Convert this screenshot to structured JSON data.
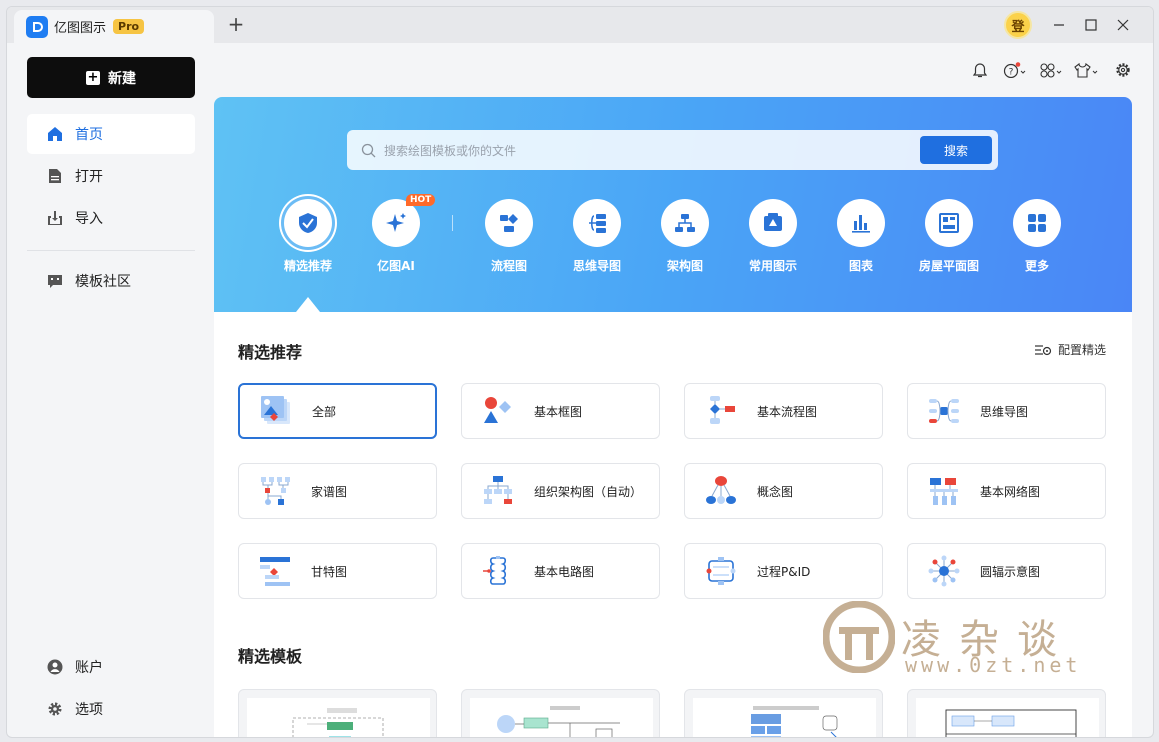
{
  "app": {
    "name": "亿图图示",
    "badge": "Pro",
    "new_tab": "+",
    "avatar_text": "登"
  },
  "sidebar": {
    "new_label": "新建",
    "items": [
      {
        "label": "首页",
        "icon": "home-icon"
      },
      {
        "label": "打开",
        "icon": "file-icon"
      },
      {
        "label": "导入",
        "icon": "import-icon"
      },
      {
        "label": "模板社区",
        "icon": "community-icon"
      },
      {
        "label": "账户",
        "icon": "account-icon"
      },
      {
        "label": "选项",
        "icon": "gear-icon"
      }
    ]
  },
  "search": {
    "placeholder": "搜索绘图模板或你的文件",
    "button": "搜索"
  },
  "categories": [
    {
      "label": "精选推荐",
      "icon": "featured-icon"
    },
    {
      "label": "亿图AI",
      "icon": "ai-sparkle-icon",
      "badge": "HOT"
    },
    {
      "label": "流程图",
      "icon": "flowchart-icon"
    },
    {
      "label": "思维导图",
      "icon": "mindmap-icon"
    },
    {
      "label": "架构图",
      "icon": "org-chart-icon"
    },
    {
      "label": "常用图示",
      "icon": "common-diagram-icon"
    },
    {
      "label": "图表",
      "icon": "bar-chart-icon"
    },
    {
      "label": "房屋平面图",
      "icon": "floor-plan-icon"
    },
    {
      "label": "更多",
      "icon": "more-grid-icon"
    }
  ],
  "featured": {
    "title": "精选推荐",
    "config_label": "配置精选",
    "cards": [
      {
        "label": "全部"
      },
      {
        "label": "基本框图"
      },
      {
        "label": "基本流程图"
      },
      {
        "label": "思维导图"
      },
      {
        "label": "家谱图"
      },
      {
        "label": "组织架构图（自动）"
      },
      {
        "label": "概念图"
      },
      {
        "label": "基本网络图"
      },
      {
        "label": "甘特图"
      },
      {
        "label": "基本电路图"
      },
      {
        "label": "过程P&ID"
      },
      {
        "label": "圆辐示意图"
      }
    ]
  },
  "templates": {
    "title": "精选模板"
  },
  "watermark": {
    "text": "凌杂谈",
    "url": "www.0zt.net"
  },
  "colors": {
    "accent": "#1f6fe0",
    "banner_start": "#5fc2f4",
    "banner_end": "#4a86f6"
  }
}
